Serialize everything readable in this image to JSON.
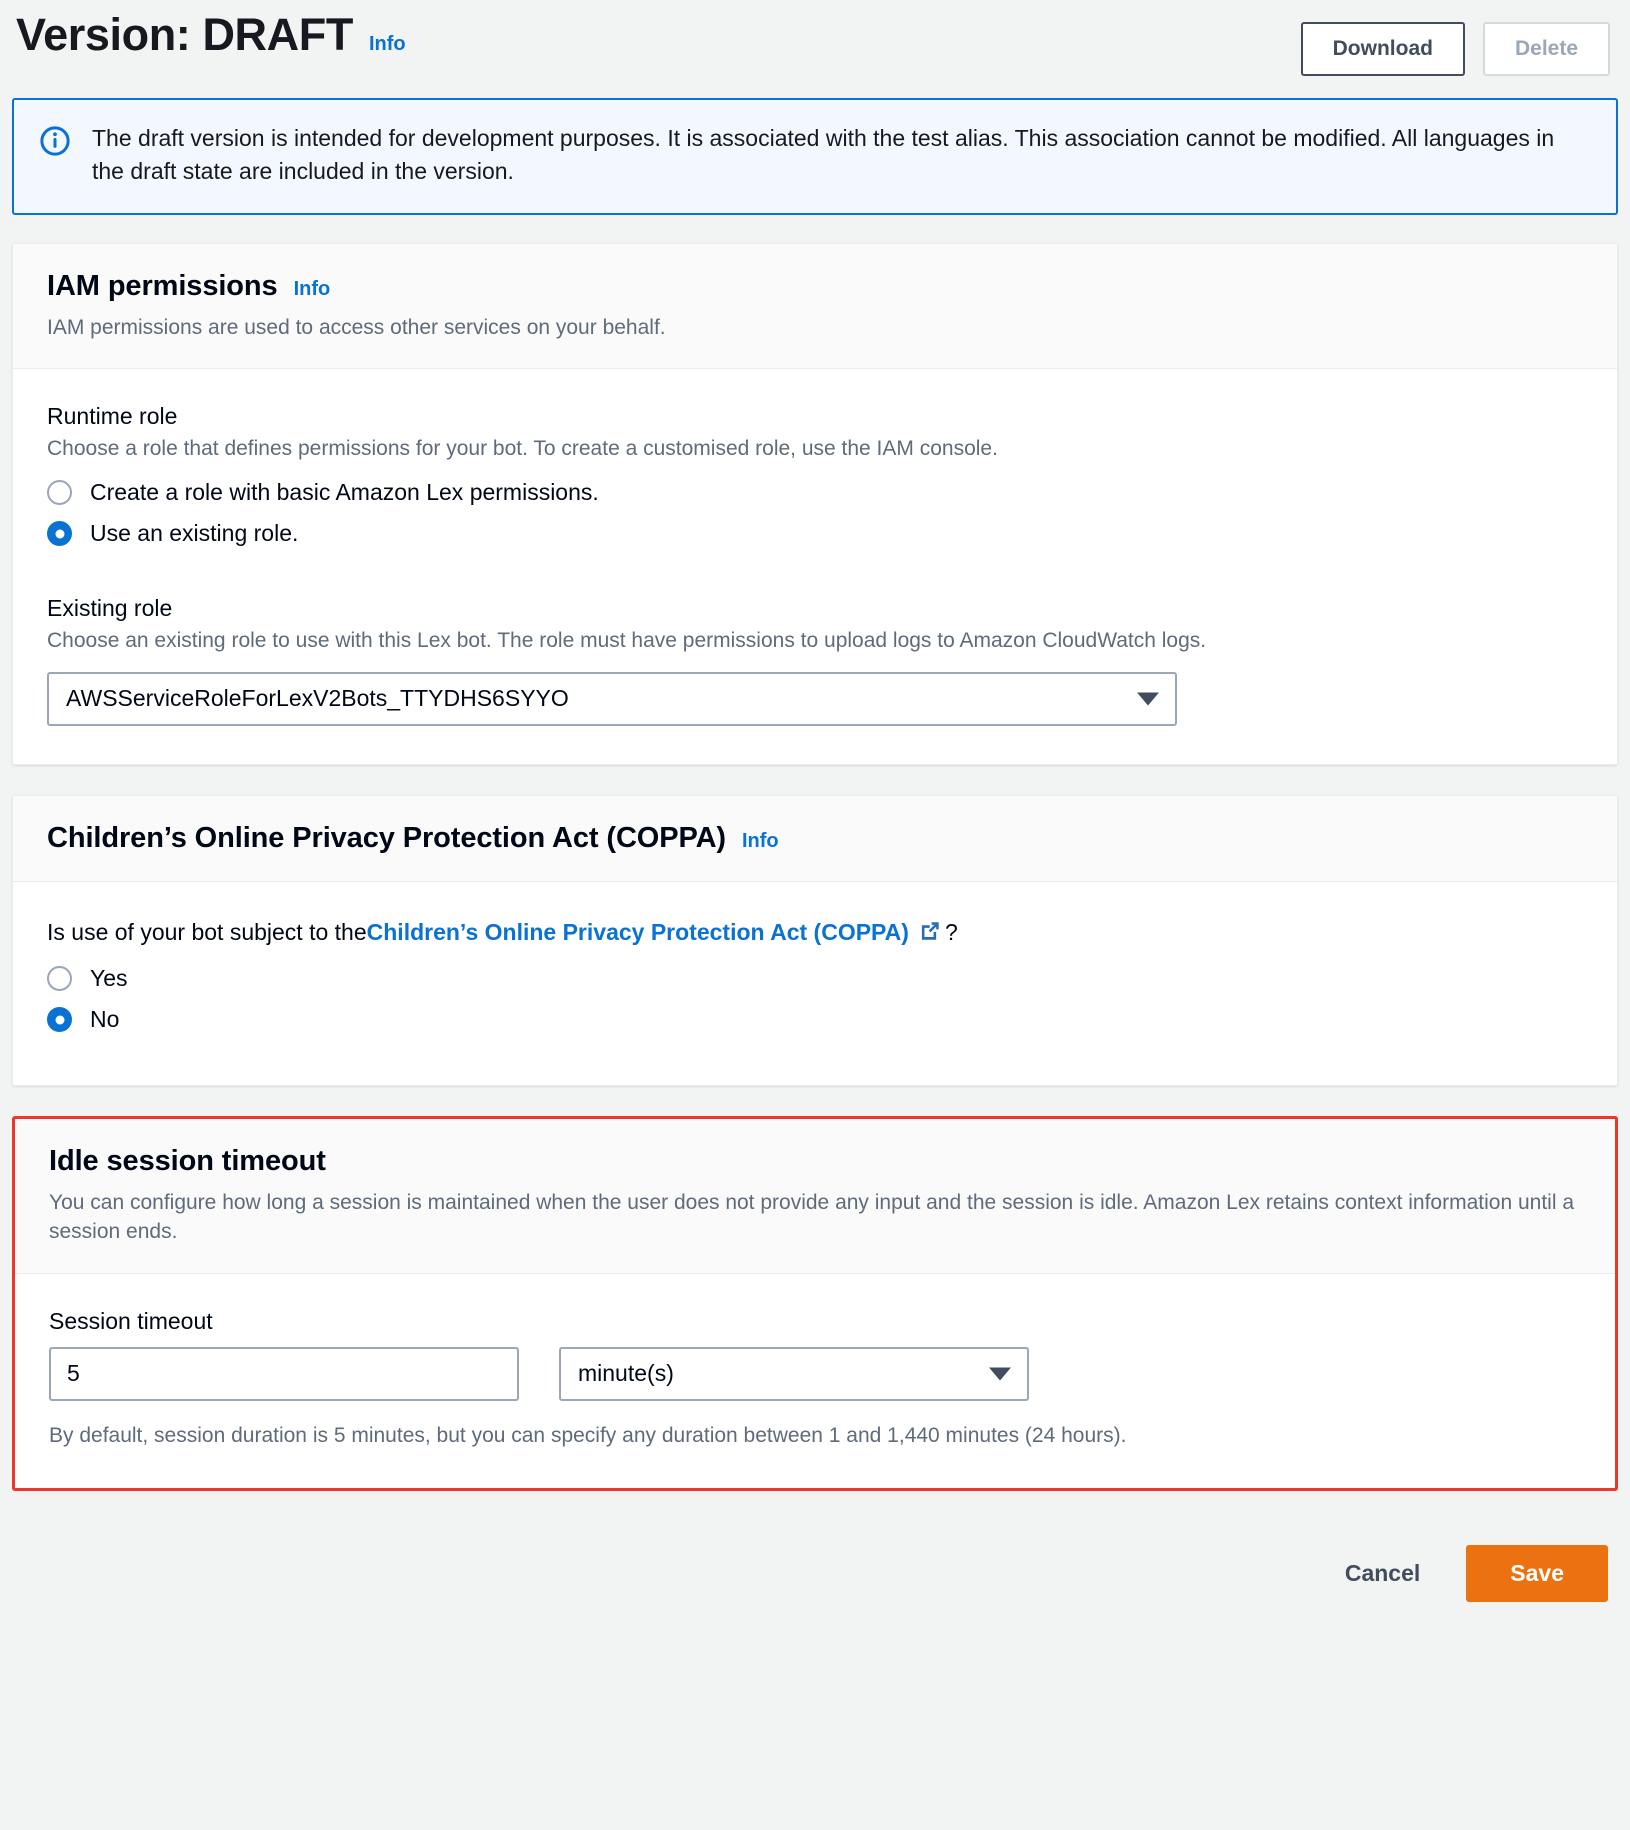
{
  "header": {
    "title": "Version: DRAFT",
    "info_label": "Info",
    "download_label": "Download",
    "delete_label": "Delete"
  },
  "alert": {
    "icon": "info-circle-icon",
    "text": "The draft version is intended for development purposes. It is associated with the test alias. This association cannot be modified. All languages in the draft state are included in the version."
  },
  "iam": {
    "title": "IAM permissions",
    "info_label": "Info",
    "description": "IAM permissions are used to access other services on your behalf.",
    "runtime_role": {
      "label": "Runtime role",
      "hint": "Choose a role that defines permissions for your bot. To create a customised role, use the IAM console.",
      "options": [
        {
          "label": "Create a role with basic Amazon Lex permissions.",
          "checked": false
        },
        {
          "label": "Use an existing role.",
          "checked": true
        }
      ]
    },
    "existing_role": {
      "label": "Existing role",
      "hint": "Choose an existing role to use with this Lex bot. The role must have permissions to upload logs to Amazon CloudWatch logs.",
      "value": "AWSServiceRoleForLexV2Bots_TTYDHS6SYYO"
    }
  },
  "coppa": {
    "title": "Children’s Online Privacy Protection Act (COPPA)",
    "info_label": "Info",
    "question_prefix": "Is use of your bot subject to the",
    "question_link": "Children’s Online Privacy Protection Act (COPPA)",
    "question_suffix": "?",
    "external_icon": "external-link-icon",
    "options": [
      {
        "label": "Yes",
        "checked": false
      },
      {
        "label": "No",
        "checked": true
      }
    ]
  },
  "idle_session": {
    "title": "Idle session timeout",
    "description": "You can configure how long a session is maintained when the user does not provide any input and the session is idle. Amazon Lex retains context information until a session ends.",
    "session_timeout_label": "Session timeout",
    "session_timeout_value": "5",
    "unit_value": "minute(s)",
    "note": "By default, session duration is 5 minutes, but you can specify any duration between 1 and 1,440 minutes (24 hours).",
    "highlight_color": "#ec372a"
  },
  "footer": {
    "cancel_label": "Cancel",
    "save_label": "Save",
    "save_color": "#ec7211"
  }
}
